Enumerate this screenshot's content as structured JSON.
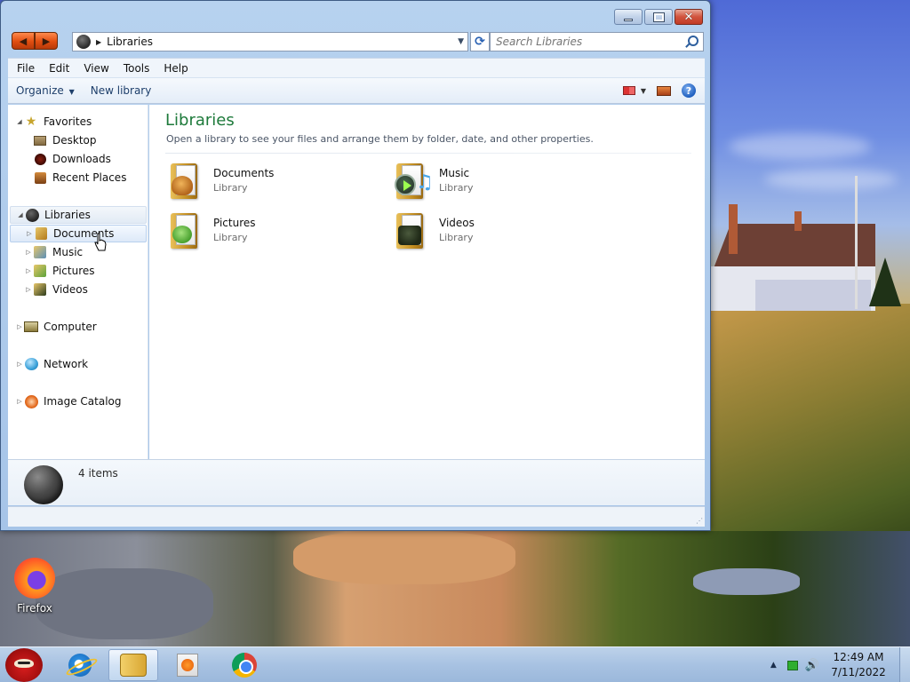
{
  "window": {
    "caption_buttons": [
      "minimize",
      "maximize",
      "close"
    ]
  },
  "navigation": {
    "address_path": "Libraries",
    "search_placeholder": "Search Libraries"
  },
  "menu": {
    "items": [
      "File",
      "Edit",
      "View",
      "Tools",
      "Help"
    ]
  },
  "command_bar": {
    "organize": "Organize",
    "new_library": "New library",
    "help_glyph": "?"
  },
  "nav_pane": {
    "favorites": "Favorites",
    "desktop": "Desktop",
    "downloads": "Downloads",
    "recent_places": "Recent Places",
    "libraries": "Libraries",
    "documents": "Documents",
    "music": "Music",
    "pictures": "Pictures",
    "videos": "Videos",
    "computer": "Computer",
    "network": "Network",
    "image_catalog": "Image Catalog"
  },
  "content": {
    "title": "Libraries",
    "subtitle": "Open a library to see your files and arrange them by folder, date, and other properties.",
    "libraries": [
      {
        "name": "Documents",
        "type": "Library",
        "icon": "documents-library-icon"
      },
      {
        "name": "Music",
        "type": "Library",
        "icon": "music-library-icon"
      },
      {
        "name": "Pictures",
        "type": "Library",
        "icon": "pictures-library-icon"
      },
      {
        "name": "Videos",
        "type": "Library",
        "icon": "videos-library-icon"
      }
    ]
  },
  "details": {
    "item_count": "4 items"
  },
  "desktop": {
    "icons": [
      {
        "label": "Firefox",
        "icon": "firefox-icon"
      }
    ]
  },
  "taskbar": {
    "pinned": [
      "internet-explorer-icon",
      "windows-explorer-icon",
      "media-player-icon",
      "chrome-icon"
    ],
    "active": "windows-explorer-icon",
    "clock_time": "12:49 AM",
    "clock_date": "7/11/2022"
  },
  "colors": {
    "accent_title": "#1e7a3b",
    "window_frame": "#b7d2ef",
    "taskbar": "#a8c2e2"
  }
}
